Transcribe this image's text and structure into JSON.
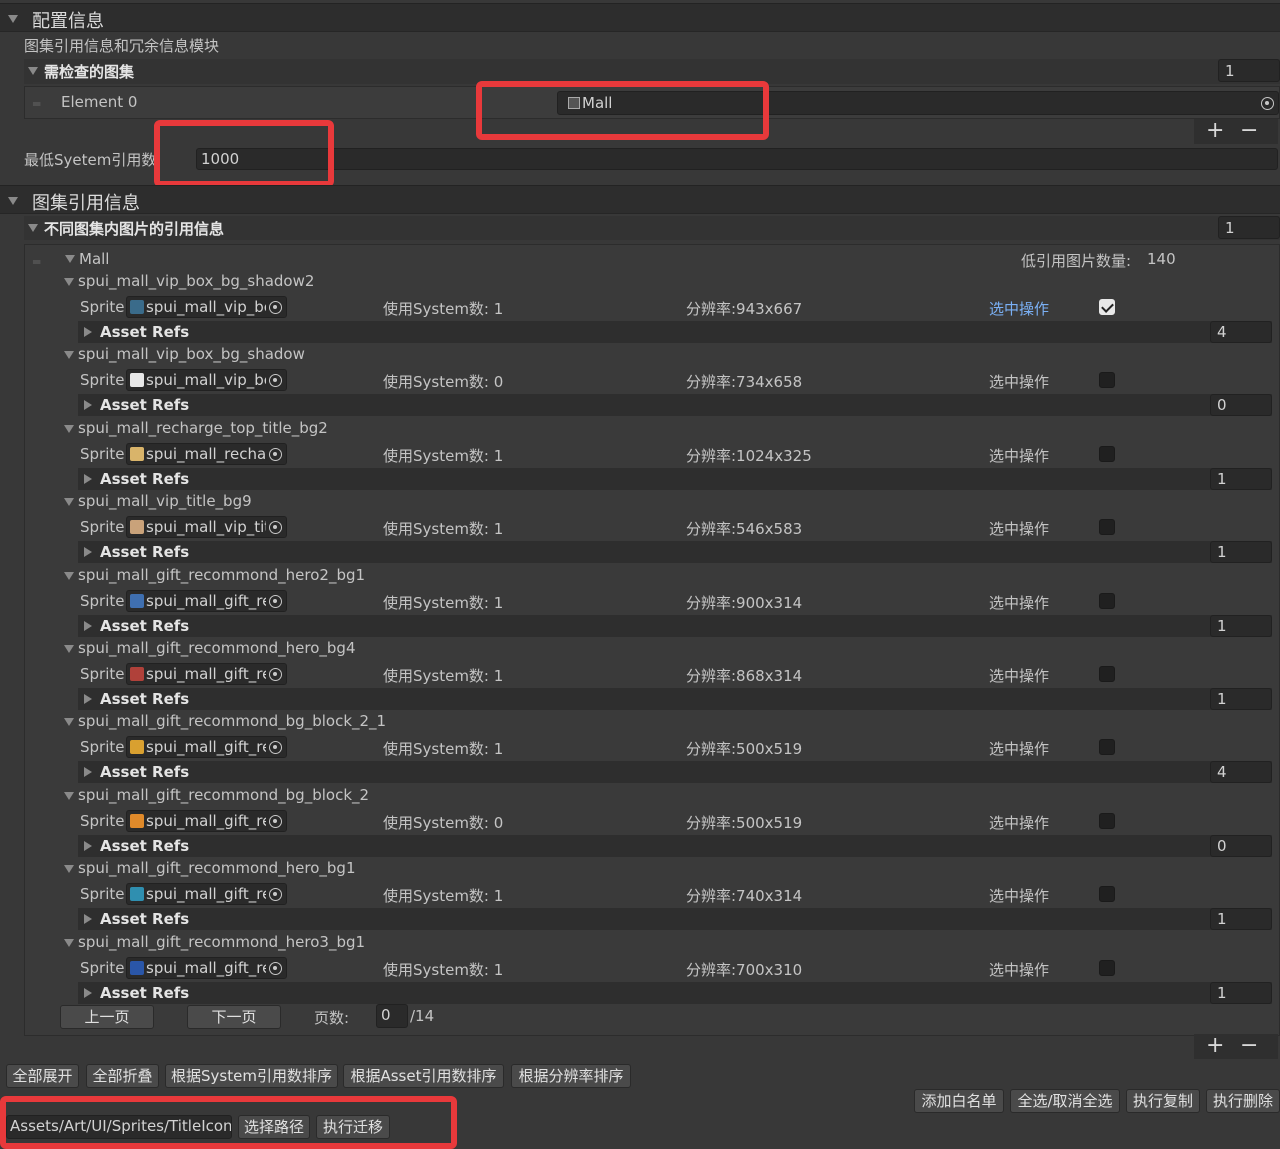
{
  "config": {
    "title": "配置信息",
    "subtitle": "图集引用信息和冗余信息模块",
    "atlas_list": {
      "label": "需检查的图集",
      "size": "1",
      "element_label": "Element 0",
      "element_value": "Mall"
    },
    "min_ref_label": "最低Syetem引用数",
    "min_ref_value": "1000"
  },
  "refinfo": {
    "title": "图集引用信息",
    "list_label": "不同图集内图片的引用信息",
    "list_size": "1",
    "group_name": "Mall",
    "low_ref_label": "低引用图片数量:",
    "low_ref_count": "140",
    "items": [
      {
        "name": "spui_mall_vip_box_bg_shadow2",
        "sprite_label": "Sprite",
        "sprite_value": "spui_mall_vip_bc",
        "system": "使用System数: 1",
        "res": "分辨率:943x667",
        "select": "选中操作",
        "checked": true,
        "refs_label": "Asset Refs",
        "refs": "4",
        "thumb": "#3a6b8a"
      },
      {
        "name": "spui_mall_vip_box_bg_shadow",
        "sprite_label": "Sprite",
        "sprite_value": "spui_mall_vip_bc",
        "system": "使用System数: 0",
        "res": "分辨率:734x658",
        "select": "选中操作",
        "checked": false,
        "refs_label": "Asset Refs",
        "refs": "0",
        "thumb": "#e8e8e8"
      },
      {
        "name": "spui_mall_recharge_top_title_bg2",
        "sprite_label": "Sprite",
        "sprite_value": "spui_mall_recha",
        "system": "使用System数: 1",
        "res": "分辨率:1024x325",
        "select": "选中操作",
        "checked": false,
        "refs_label": "Asset Refs",
        "refs": "1",
        "thumb": "#d9b46a"
      },
      {
        "name": "spui_mall_vip_title_bg9",
        "sprite_label": "Sprite",
        "sprite_value": "spui_mall_vip_tit",
        "system": "使用System数: 1",
        "res": "分辨率:546x583",
        "select": "选中操作",
        "checked": false,
        "refs_label": "Asset Refs",
        "refs": "1",
        "thumb": "#c9a27a"
      },
      {
        "name": "spui_mall_gift_recommond_hero2_bg1",
        "sprite_label": "Sprite",
        "sprite_value": "spui_mall_gift_re",
        "system": "使用System数: 1",
        "res": "分辨率:900x314",
        "select": "选中操作",
        "checked": false,
        "refs_label": "Asset Refs",
        "refs": "1",
        "thumb": "#3f6fb0"
      },
      {
        "name": "spui_mall_gift_recommond_hero_bg4",
        "sprite_label": "Sprite",
        "sprite_value": "spui_mall_gift_re",
        "system": "使用System数: 1",
        "res": "分辨率:868x314",
        "select": "选中操作",
        "checked": false,
        "refs_label": "Asset Refs",
        "refs": "1",
        "thumb": "#b0413a"
      },
      {
        "name": "spui_mall_gift_recommond_bg_block_2_1",
        "sprite_label": "Sprite",
        "sprite_value": "spui_mall_gift_re",
        "system": "使用System数: 1",
        "res": "分辨率:500x519",
        "select": "选中操作",
        "checked": false,
        "refs_label": "Asset Refs",
        "refs": "4",
        "thumb": "#d9a030"
      },
      {
        "name": "spui_mall_gift_recommond_bg_block_2",
        "sprite_label": "Sprite",
        "sprite_value": "spui_mall_gift_re",
        "system": "使用System数: 0",
        "res": "分辨率:500x519",
        "select": "选中操作",
        "checked": false,
        "refs_label": "Asset Refs",
        "refs": "0",
        "thumb": "#e08a2a"
      },
      {
        "name": "spui_mall_gift_recommond_hero_bg1",
        "sprite_label": "Sprite",
        "sprite_value": "spui_mall_gift_re",
        "system": "使用System数: 1",
        "res": "分辨率:740x314",
        "select": "选中操作",
        "checked": false,
        "refs_label": "Asset Refs",
        "refs": "1",
        "thumb": "#2f8fb0"
      },
      {
        "name": "spui_mall_gift_recommond_hero3_bg1",
        "sprite_label": "Sprite",
        "sprite_value": "spui_mall_gift_re",
        "system": "使用System数: 1",
        "res": "分辨率:700x310",
        "select": "选中操作",
        "checked": false,
        "refs_label": "Asset Refs",
        "refs": "1",
        "thumb": "#2a56a8"
      }
    ],
    "pager": {
      "prev": "上一页",
      "next": "下一页",
      "page_label": "页数:",
      "page_value": "0",
      "total": "/14"
    }
  },
  "actions": {
    "expand_all": "全部展开",
    "collapse_all": "全部折叠",
    "sort_system": "根据System引用数排序",
    "sort_asset": "根据Asset引用数排序",
    "sort_res": "根据分辨率排序",
    "add_whitelist": "添加白名单",
    "toggle_select": "全选/取消全选",
    "exec_copy": "执行复制",
    "exec_delete": "执行删除",
    "path_value": "Assets/Art/UI/Sprites/TitleIcon",
    "choose_path": "选择路径",
    "exec_migrate": "执行迁移"
  },
  "colors": {
    "link_blue": "#7ab0f5",
    "highlight_red": "#e8393b"
  }
}
